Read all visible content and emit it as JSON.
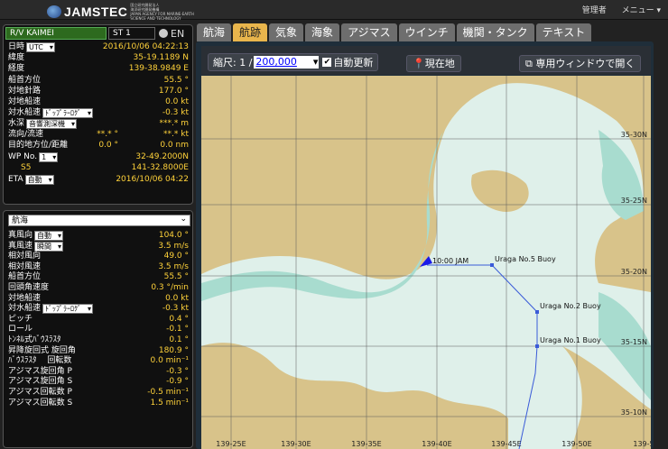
{
  "header": {
    "logo_text": "JAMSTEC",
    "logo_sub_1": "国立研究開発法人",
    "logo_sub_2": "海洋研究開発機構",
    "logo_sub_3": "JAPAN AGENCY FOR MARINE-EARTH SCIENCE AND TECHNOLOGY",
    "admin": "管理者",
    "menu": "メニュー ▾"
  },
  "ship": {
    "name": "R/V KAIMEI",
    "station": "ST 1",
    "lang": "EN"
  },
  "nav": {
    "datetime_label": "日時",
    "datetime_sel": "UTC",
    "datetime": "2016/10/06 04:22:13",
    "lat_label": "緯度",
    "lat": "35-19.1189 N",
    "lon_label": "経度",
    "lon": "139-38.9849 E",
    "heading_label": "船首方位",
    "heading": "55.5 °",
    "cog_label": "対地針路",
    "cog": "177.0 °",
    "sog_label": "対地船速",
    "sog": "0.0 kt",
    "stw_label": "対水船速",
    "stw_sel": "ﾄﾞｯﾌﾟﾗｰﾛｸﾞ",
    "stw": "-0.3 kt",
    "depth_label": "水深",
    "depth_sel": "音響測深機",
    "depth": "***.* m",
    "current_label": "流向/流速",
    "current_dir": "**.* °",
    "current_spd": "**.* kt",
    "dest_label": "目的地方位/距離",
    "dest_brg": "0.0 °",
    "dest_dist": "0.0 nm",
    "wp_label": "WP No.",
    "wp_sel": "1",
    "wp_lat": "32-49.2000N",
    "wp_name": "S5",
    "wp_lon": "141-32.8000E",
    "eta_label": "ETA",
    "eta_sel": "自動",
    "eta": "2016/10/06 04:22"
  },
  "cat": {
    "selected": "航海",
    "rows": [
      {
        "label": "真風向",
        "sel": "自動",
        "value": "104.0 °"
      },
      {
        "label": "真風速",
        "sel": "瞬間",
        "value": "3.5 m/s"
      },
      {
        "label": "相対風向",
        "value": "49.0 °"
      },
      {
        "label": "相対風速",
        "value": "3.5 m/s"
      },
      {
        "label": "船首方位",
        "value": "55.5 °"
      },
      {
        "label": "回頭角速度",
        "value": "0.3 °/min"
      },
      {
        "label": "対地船速",
        "value": "0.0 kt"
      },
      {
        "label": "対水船速",
        "sel": "ﾄﾞｯﾌﾟﾗｰﾛｸﾞ",
        "value": "-0.3 kt"
      },
      {
        "label": "ピッチ",
        "value": "0.4 °"
      },
      {
        "label": "ロール",
        "value": "-0.1 °"
      },
      {
        "label": "ﾄﾝﾈﾙ式ﾊﾞｳｽﾗｽﾀ",
        "value": "0.1 °"
      },
      {
        "label": "昇降旋回式 旋回角",
        "value": "180.9 °"
      },
      {
        "label": "ﾊﾞｳｽﾗｽﾀ　 回転数",
        "value": "0.0 min⁻¹"
      },
      {
        "label": "アジマス旋回角 P",
        "value": "-0.3 °"
      },
      {
        "label": "アジマス旋回角 S",
        "value": "-0.9 °"
      },
      {
        "label": "アジマス回転数 P",
        "value": "-0.5 min⁻¹"
      },
      {
        "label": "アジマス回転数 S",
        "value": "1.5 min⁻¹"
      }
    ]
  },
  "tabs": [
    "航海",
    "航跡",
    "気象",
    "海象",
    "アジマス",
    "ウインチ",
    "機関・タンク",
    "テキスト"
  ],
  "active_tab": 1,
  "toolbar": {
    "scale_label": "縮尺: 1 /",
    "scale_value": "200,000",
    "auto_update": "自動更新",
    "current_pos": "現在地",
    "open_window": "専用ウィンドウで開く"
  },
  "map": {
    "lat_labels": [
      "35-30N",
      "35-25N",
      "35-20N",
      "35-15N",
      "35-10N"
    ],
    "lon_labels": [
      "139-25E",
      "139-30E",
      "139-35E",
      "139-40E",
      "139-45E",
      "139-50E",
      "139-5"
    ],
    "waypoints": [
      "Uraga No.5 Buoy",
      "Uraga No.2 Buoy",
      "Uraga No.1 Buoy"
    ],
    "ship_label": "JAM",
    "ship_time": "10:00",
    "colors": {
      "land": "#d8c38a",
      "shallow": "#a8dccf",
      "sea": "#dff0ea",
      "route": "#3a5bd8",
      "ship": "#1a1ae8"
    }
  }
}
